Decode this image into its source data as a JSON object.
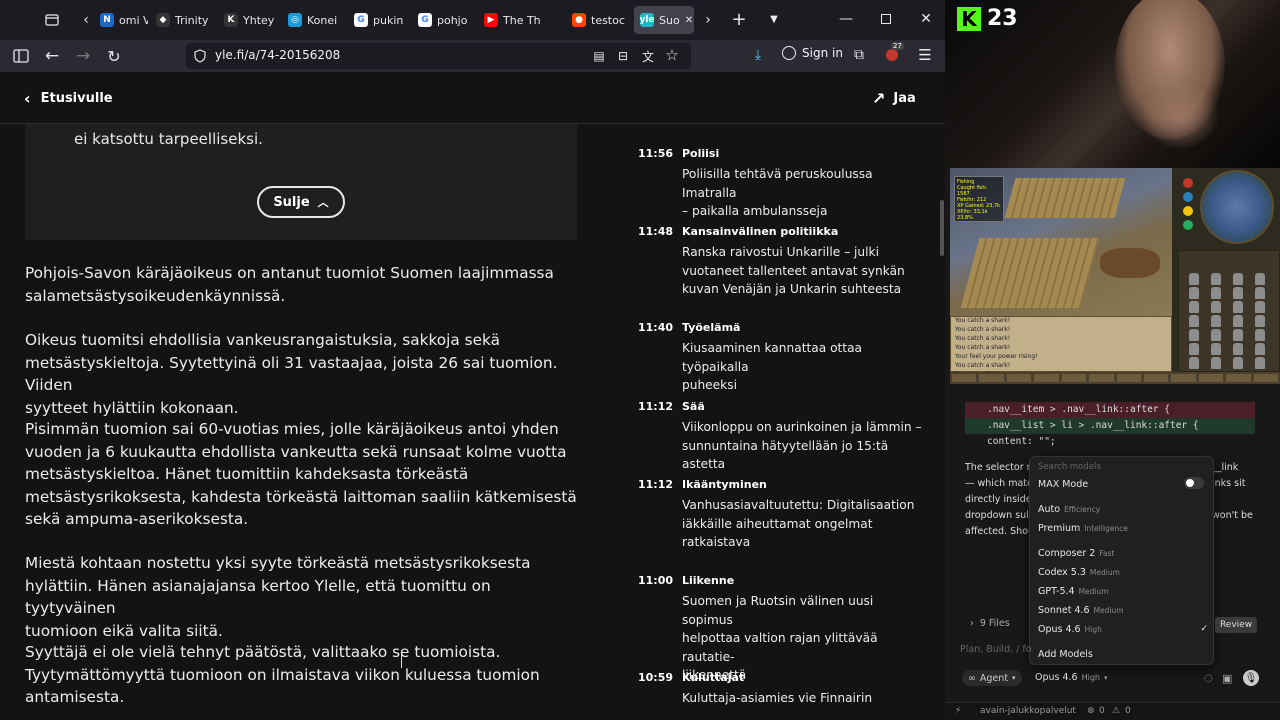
{
  "browser": {
    "tabs": [
      {
        "label": "omi Välin",
        "icon": "N",
        "color": "#1b6ac9"
      },
      {
        "label": "Trinity",
        "icon": "◆",
        "color": "#333"
      },
      {
        "label": "Yhtey",
        "icon": "K",
        "color": "#333"
      },
      {
        "label": "Konei",
        "icon": "◎",
        "color": "#1a9bd7"
      },
      {
        "label": "pukin",
        "icon": "G",
        "color": "#fff"
      },
      {
        "label": "pohjo",
        "icon": "G",
        "color": "#fff"
      },
      {
        "label": "The Th",
        "icon": "▶",
        "color": "#f00"
      },
      {
        "label": "testoc",
        "icon": "●",
        "color": "#ff4500"
      },
      {
        "label": "Suo",
        "icon": "yle",
        "color": "#21b5c6"
      }
    ],
    "url": "yle.fi/a/74-20156208",
    "signin": "Sign in",
    "ext_badge": "27"
  },
  "page": {
    "back_label": "Etusivulle",
    "share_label": "Jaa",
    "factbox_text": "ei katsottu tarpeelliseksi.",
    "close_label": "Sulje",
    "paragraphs": [
      [
        "Pohjois-Savon käräjäoikeus on antanut tuomiot Suomen laajimmassa",
        "salametsästysoikeudenkäynnissä."
      ],
      [
        "Oikeus tuomitsi ehdollisia vankeusrangaistuksia, sakkoja sekä",
        "metsästyskieltoja. Syytettyinä oli 31 vastaajaa, joista 26 sai tuomion. Viiden",
        "syytteet hylättiin kokonaan."
      ],
      [
        "Pisimmän tuomion sai 60-vuotias mies, jolle käräjäoikeus antoi yhden",
        "vuoden ja 6 kuukautta ehdollista vankeutta sekä runsaat kolme vuotta",
        "metsästyskieltoa. Hänet tuomittiin kahdeksasta törkeästä",
        "metsästysrikoksesta, kahdesta törkeästä laittoman saaliin kätkemisestä",
        "sekä ampuma-aserikoksesta."
      ],
      [
        "Miestä kohtaan nostettu yksi syyte törkeästä metsästysrikoksesta",
        "hylättiin. Hänen asianajajansa kertoo Ylelle, että tuomittu on tyytyväinen",
        "tuomioon eikä valita siitä."
      ],
      [
        "Syyttäjä ei ole vielä tehnyt päätöstä, valittaako se tuomioista.",
        "Tyytymättömyyttä tuomioon on ilmaistava viikon kuluessa tuomion",
        "antamisesta."
      ]
    ],
    "live_feed": [
      {
        "time": "11:56",
        "category": "Poliisi",
        "title": [
          "Poliisilla tehtävä peruskoulussa Imatralla",
          "– paikalla ambulansseja"
        ]
      },
      {
        "time": "11:48",
        "category": "Kansainvälinen politiikka",
        "title": [
          "Ranska raivostui Unkarille – julki",
          "vuotaneet tallenteet antavat synkän",
          "kuvan Venäjän ja Unkarin suhteesta"
        ]
      },
      {
        "time": "11:40",
        "category": "Työelämä",
        "title": [
          "Kiusaaminen kannattaa ottaa työpaikalla",
          "puheeksi"
        ]
      },
      {
        "time": "11:12",
        "category": "Sää",
        "title": [
          "Viikonloppu on aurinkoinen ja lämmin –",
          "sunnuntaina hätyytellään jo 15:tä astetta"
        ]
      },
      {
        "time": "11:12",
        "category": "Ikääntyminen",
        "title": [
          "Vanhusasiavaltuutettu: Digitalisaation",
          "iäkkäille aiheuttamat ongelmat",
          "ratkaistava"
        ]
      },
      {
        "time": "11:00",
        "category": "Liikenne",
        "title": [
          "Suomen ja Ruotsin välinen uusi sopimus",
          "helpottaa valtion rajan ylittävää rautatie-",
          "liikennettä"
        ]
      },
      {
        "time": "10:59",
        "category": "Kuluttajat",
        "title": [
          "Kuluttaja-asiamies vie Finnairin",
          ""
        ]
      }
    ]
  },
  "stream": {
    "kick_count": "23"
  },
  "game": {
    "chat_lines": [
      "You catch a shark!",
      "You catch a shark!",
      "You catch a shark!",
      "You catch a shark!",
      "Your feel your power rising!",
      "You catch a shark!",
      "Pop a bee fishing: smoke you catch a shark!"
    ],
    "stats": [
      "Fishing",
      "Caught fish: 1587",
      "Fish/hr: 212",
      "XP Gained: 23,7k",
      "XP/hr: 33,1k",
      "23.8%"
    ]
  },
  "editor": {
    "code_lines": [
      {
        "text": ".nav__item > .nav__link::after {",
        "kind": "del"
      },
      {
        "text": ".nav__list > li > .nav__link::after {",
        "kind": "add"
      },
      {
        "text": "  content: \"\";",
        "kind": "plain"
      }
    ],
    "prose_lines": [
      {
        "left": "The selector r",
        "right": "__link"
      },
      {
        "left": "— which matc",
        "right": "inks sit"
      },
      {
        "left": "directly inside",
        "right": ""
      },
      {
        "left": "dropdown sul",
        "right": "won't be"
      },
      {
        "left": "affected. Shou",
        "right": ""
      }
    ],
    "menu": {
      "search_placeholder": "Search models",
      "max_mode": "MAX Mode",
      "auto": {
        "label": "Auto",
        "sub": "Efficiency"
      },
      "premium": {
        "label": "Premium",
        "sub": "Intelligence"
      },
      "models": [
        {
          "label": "Composer 2",
          "sub": "Fast"
        },
        {
          "label": "Codex 5.3",
          "sub": "Medium"
        },
        {
          "label": "GPT-5.4",
          "sub": "Medium"
        },
        {
          "label": "Sonnet 4.6",
          "sub": "Medium"
        },
        {
          "label": "Opus 4.6",
          "sub": "High",
          "checked": true
        }
      ],
      "add_models": "Add Models"
    },
    "files_label": "9 Files",
    "review_label": "Review",
    "plan_placeholder": "Plan, Build, / fo",
    "agent_label": "Agent",
    "model_label": "Opus 4.6",
    "model_effort": "High",
    "status_branch": "avain-jalukkopalvelut",
    "status_errors": "0",
    "status_warnings": "0"
  }
}
